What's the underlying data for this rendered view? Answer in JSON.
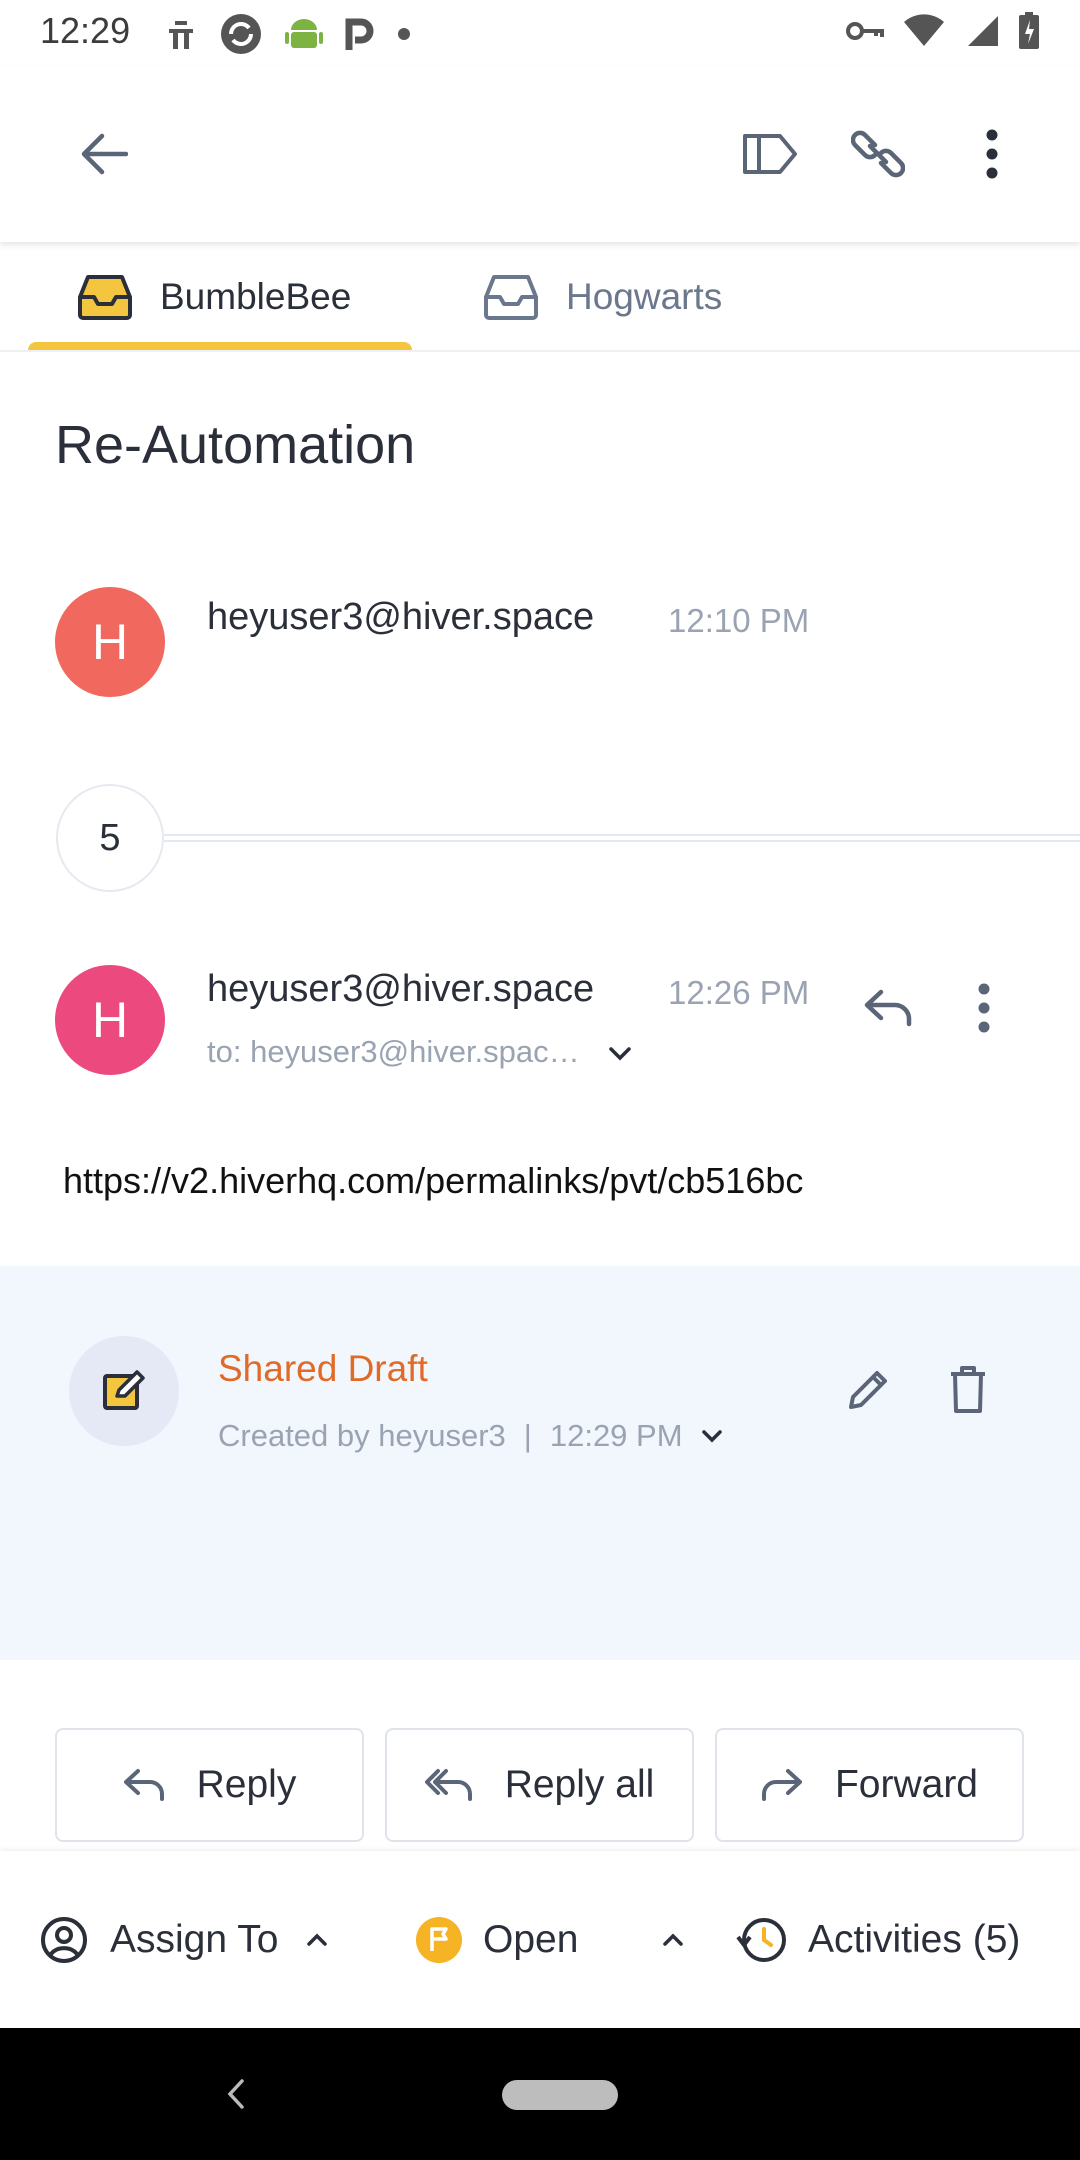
{
  "status_bar": {
    "time": "12:29",
    "left_icons": [
      "app-icon",
      "sync-icon",
      "android-icon",
      "p-icon",
      "dot-icon"
    ],
    "right_icons": [
      "key-icon",
      "wifi-icon",
      "signal-icon",
      "battery-icon"
    ]
  },
  "app_bar": {
    "icons": [
      "back-arrow-icon",
      "label-icon",
      "link-icon",
      "more-vert-icon"
    ]
  },
  "tabs": [
    {
      "label": "BumbleBee",
      "active": true
    },
    {
      "label": "Hogwarts",
      "active": false
    }
  ],
  "subject": "Re-Automation",
  "messages": [
    {
      "avatar_letter": "H",
      "avatar_color": "#f1685e",
      "sender": "heyuser3@hiver.space",
      "time": "12:10 PM"
    },
    {
      "avatar_letter": "H",
      "avatar_color": "#ec4a7f",
      "sender": "heyuser3@hiver.space",
      "time": "12:26 PM",
      "to": "to: heyuser3@hiver.spac…",
      "body": "https://v2.hiverhq.com/permalinks/pvt/cb516bc"
    }
  ],
  "collapsed_count": "5",
  "draft": {
    "title": "Shared Draft",
    "created_by": "Created by heyuser3",
    "separator": "|",
    "time": "12:29 PM"
  },
  "actions": {
    "reply": "Reply",
    "reply_all": "Reply all",
    "forward": "Forward"
  },
  "bottom_bar": {
    "assign": "Assign To",
    "status": "Open",
    "activities": "Activities (5)"
  },
  "colors": {
    "accent_tab": "#f4c53f",
    "draft_title": "#e06a26",
    "status_open": "#f6b324"
  }
}
